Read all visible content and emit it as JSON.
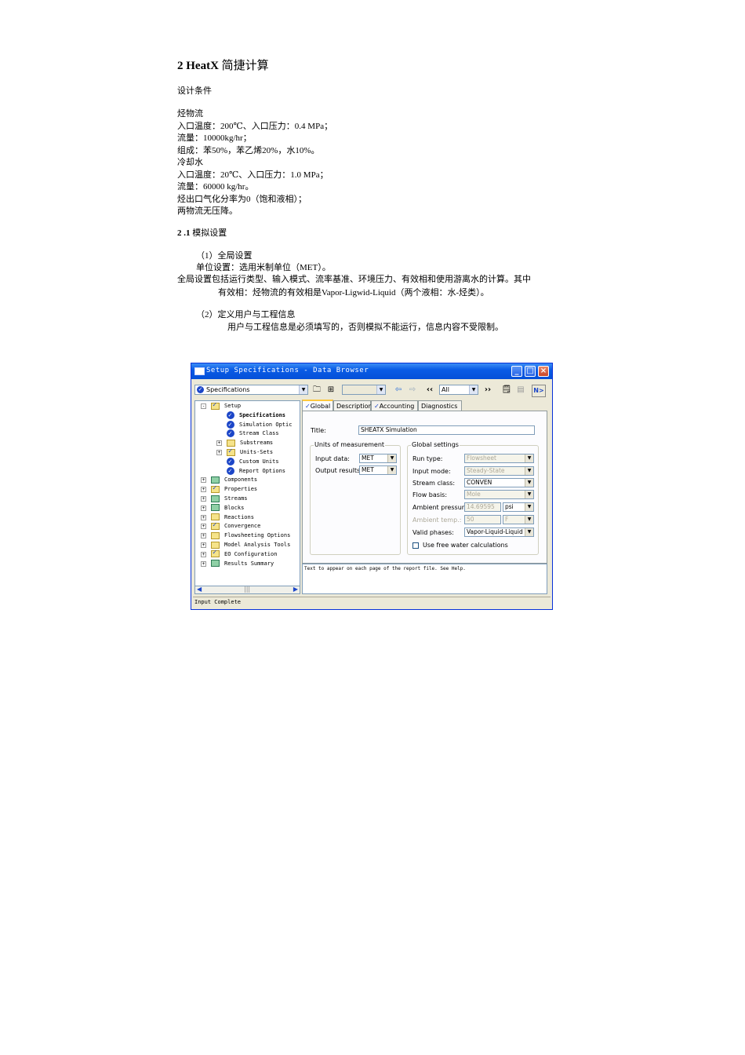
{
  "doc": {
    "heading_num": "2",
    "heading_bold": "HeatX",
    "heading_rest": "简捷计算",
    "design_conditions": "设计条件",
    "lines": [
      "烃物流",
      "入口温度：200℃、入口压力：0.4 MPa；",
      "流量：10000kg/hr；",
      "组成：苯50%，苯乙烯20%，水10%。",
      "冷却水",
      "入口温度：20℃、入口压力：1.0 MPa；",
      "流量：60000 kg/hr。",
      "烃出口气化分率为0（饱和液相）；",
      "两物流无压降。"
    ],
    "section_num": "2 .1",
    "section_title": "模拟设置",
    "p1": "（1）全局设置",
    "p2": "单位设置：选用米制单位（MET）。",
    "p3": "全局设置包括运行类型、输入模式、流率基准、环境压力、有效相和使用游离水的计算。其中",
    "p4": "有效相：烃物流的有效相是Vapor-Ligwid-Liquid（两个液相：水-烃类）。",
    "p5": "（2）定义用户与工程信息",
    "p6": "用户与工程信息是必须填写的，否则模拟不能运行，信息内容不受限制。"
  },
  "window": {
    "title": "Setup Specifications - Data Browser",
    "nav_combo": "Specifications",
    "filter_combo": "All",
    "tree": [
      {
        "label": "Setup",
        "bold": false,
        "icon": "folder-check-icon"
      },
      {
        "label": "Specifications",
        "bold": true,
        "icon": "check-icon"
      },
      {
        "label": "Simulation Optic",
        "bold": false,
        "icon": "check-icon"
      },
      {
        "label": "Stream Class",
        "bold": false,
        "icon": "check-icon"
      },
      {
        "label": "Substreams",
        "bold": false,
        "icon": "folder-icon"
      },
      {
        "label": "Units-Sets",
        "bold": false,
        "icon": "folder-check-icon"
      },
      {
        "label": "Custom Units",
        "bold": false,
        "icon": "check-icon"
      },
      {
        "label": "Report Options",
        "bold": false,
        "icon": "check-icon"
      },
      {
        "label": "Components",
        "bold": false,
        "icon": "folder-mountain-icon"
      },
      {
        "label": "Properties",
        "bold": false,
        "icon": "folder-check-icon"
      },
      {
        "label": "Streams",
        "bold": false,
        "icon": "folder-mountain-icon"
      },
      {
        "label": "Blocks",
        "bold": false,
        "icon": "folder-mountain-icon"
      },
      {
        "label": "Reactions",
        "bold": false,
        "icon": "folder-icon"
      },
      {
        "label": "Convergence",
        "bold": false,
        "icon": "folder-check-icon"
      },
      {
        "label": "Flowsheeting Options",
        "bold": false,
        "icon": "folder-icon"
      },
      {
        "label": "Model Analysis Tools",
        "bold": false,
        "icon": "folder-icon"
      },
      {
        "label": "EO Configuration",
        "bold": false,
        "icon": "folder-check-icon"
      },
      {
        "label": "Results Summary",
        "bold": false,
        "icon": "folder-mountain-icon"
      }
    ],
    "tabs": [
      "Global",
      "Description",
      "Accounting",
      "Diagnostics"
    ],
    "title_label": "Title:",
    "title_value": "SHEATX Simulation",
    "units_group": "Units of measurement",
    "input_data_label": "Input data:",
    "input_data_value": "MET",
    "output_results_label": "Output results:",
    "output_results_value": "MET",
    "global_group": "Global settings",
    "run_type_label": "Run type:",
    "run_type_value": "Flowsheet",
    "input_mode_label": "Input mode:",
    "input_mode_value": "Steady-State",
    "stream_class_label": "Stream class:",
    "stream_class_value": "CONVEN",
    "flow_basis_label": "Flow basis:",
    "flow_basis_value": "Mole",
    "ambient_pressure_label": "Ambient pressure:",
    "ambient_pressure_value": "14.69595",
    "ambient_pressure_unit": "psi",
    "ambient_temp_label": "Ambient temp.:",
    "ambient_temp_value": "50",
    "ambient_temp_unit": "F",
    "valid_phases_label": "Valid phases:",
    "valid_phases_value": "Vapor-Liquid-Liquid",
    "free_water_label": "Use free water calculations",
    "description_text": "Text to appear on each page of the report file. See Help.",
    "status": "Input Complete"
  }
}
